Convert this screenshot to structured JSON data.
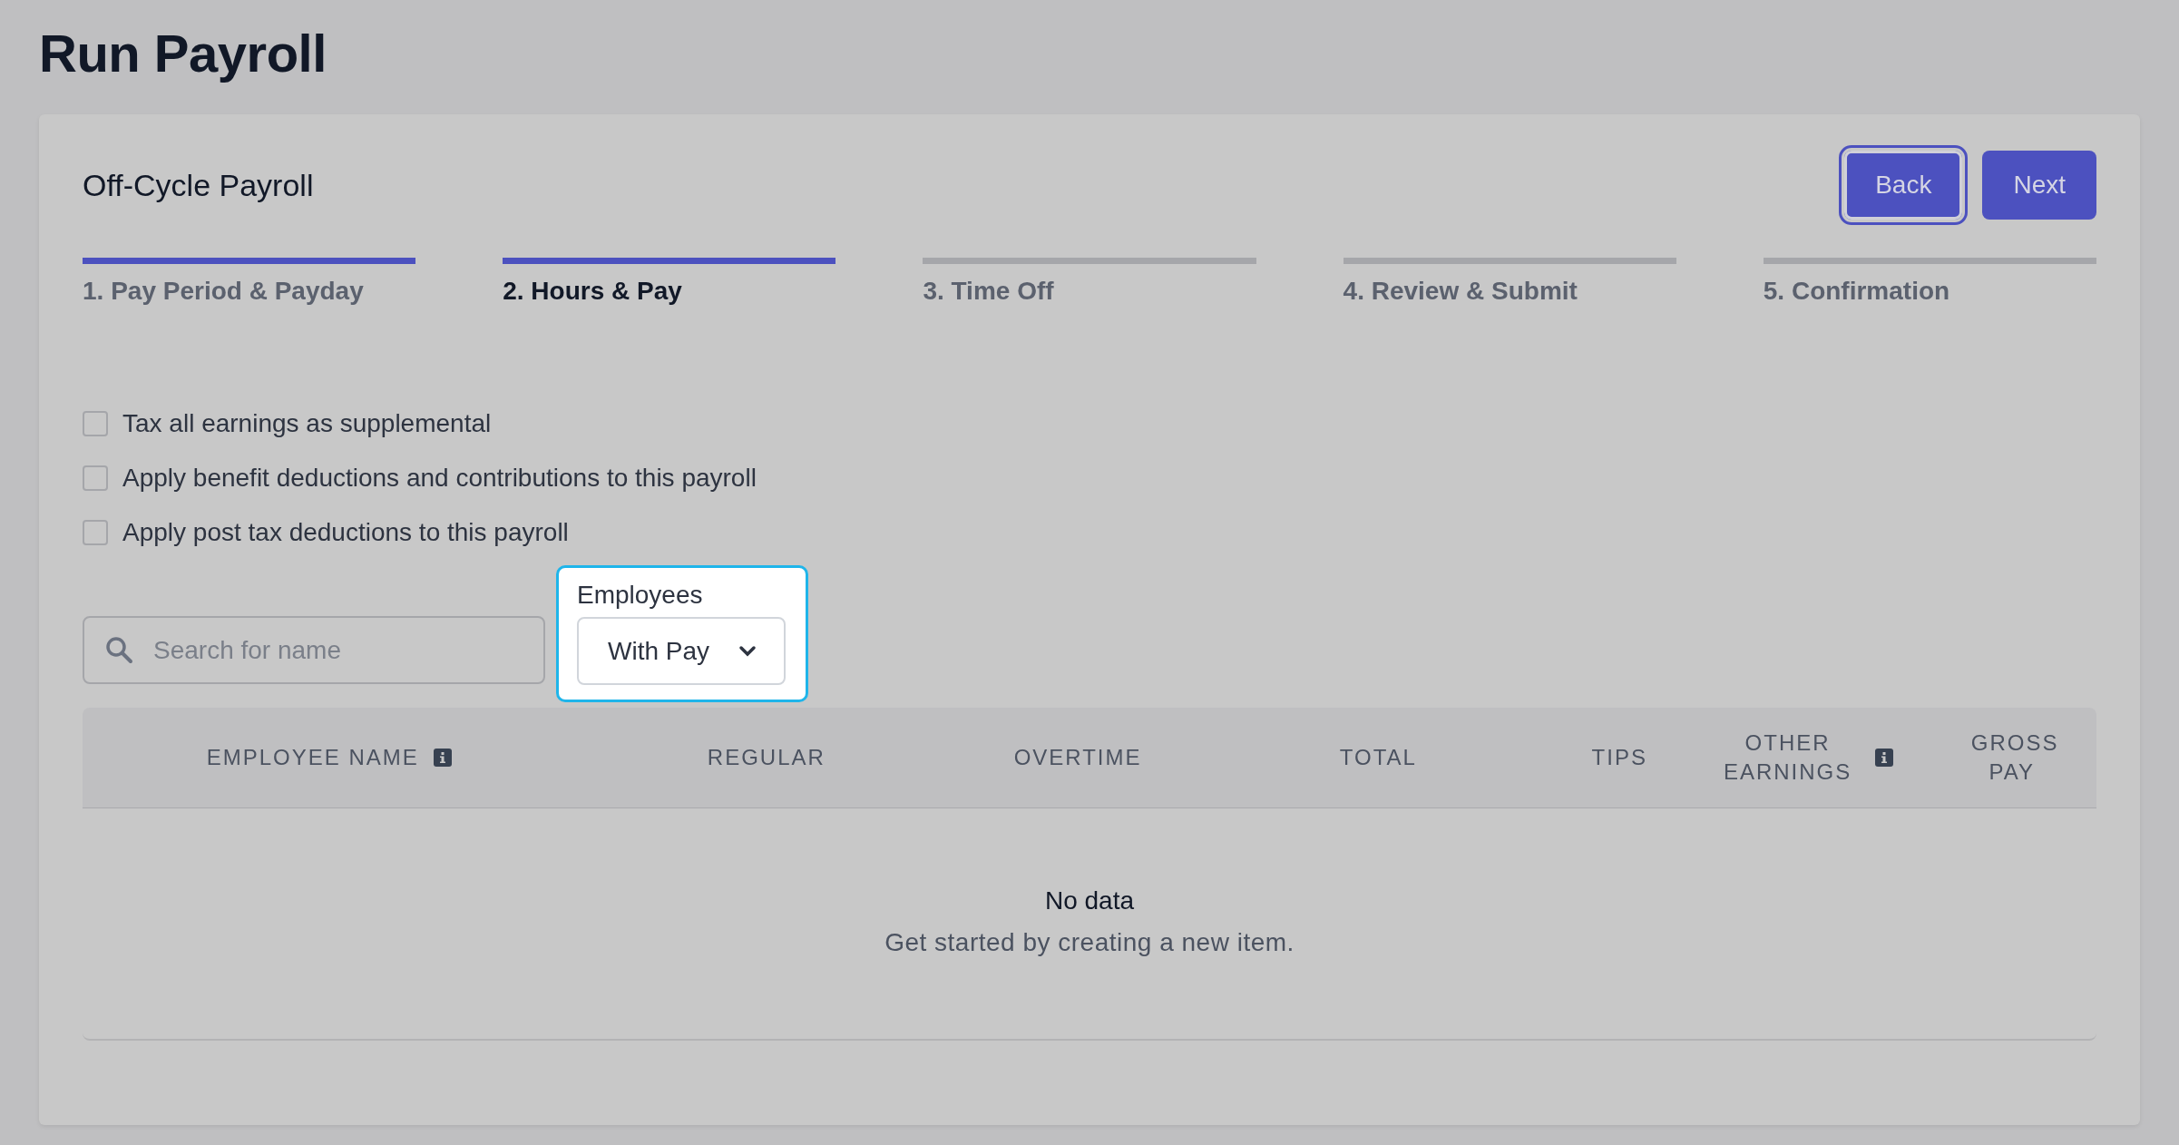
{
  "page_title": "Run Payroll",
  "card": {
    "title": "Off-Cycle Payroll",
    "buttons": [
      {
        "label": "Back",
        "focused": true
      },
      {
        "label": "Next",
        "focused": false
      }
    ],
    "steps": [
      {
        "label": "1. Pay Period & Payday",
        "done": true,
        "selected": false
      },
      {
        "label": "2. Hours & Pay",
        "done": true,
        "selected": true
      },
      {
        "label": "3. Time Off",
        "done": false,
        "selected": false
      },
      {
        "label": "4. Review & Submit",
        "done": false,
        "selected": false
      },
      {
        "label": "5. Confirmation",
        "done": false,
        "selected": false
      }
    ],
    "options": [
      {
        "label": "Tax all earnings as supplemental",
        "checked": false
      },
      {
        "label": "Apply benefit deductions and contributions to this payroll",
        "checked": false
      },
      {
        "label": "Apply post tax deductions to this payroll",
        "checked": false
      }
    ],
    "search": {
      "placeholder": "Search for name"
    },
    "employees_filter": {
      "label": "Employees",
      "value": "With Pay",
      "highlighted": true
    },
    "table": {
      "columns": [
        {
          "label": "EMPLOYEE NAME",
          "info": true
        },
        {
          "label": "REGULAR",
          "info": false
        },
        {
          "label": "OVERTIME",
          "info": false
        },
        {
          "label": "TOTAL",
          "info": false
        },
        {
          "label": "TIPS",
          "info": false
        },
        {
          "label": "OTHER EARNINGS",
          "info": true
        },
        {
          "label": "GROSS PAY",
          "info": false
        }
      ],
      "empty_title": "No data",
      "empty_text": "Get started by creating a new item."
    }
  }
}
